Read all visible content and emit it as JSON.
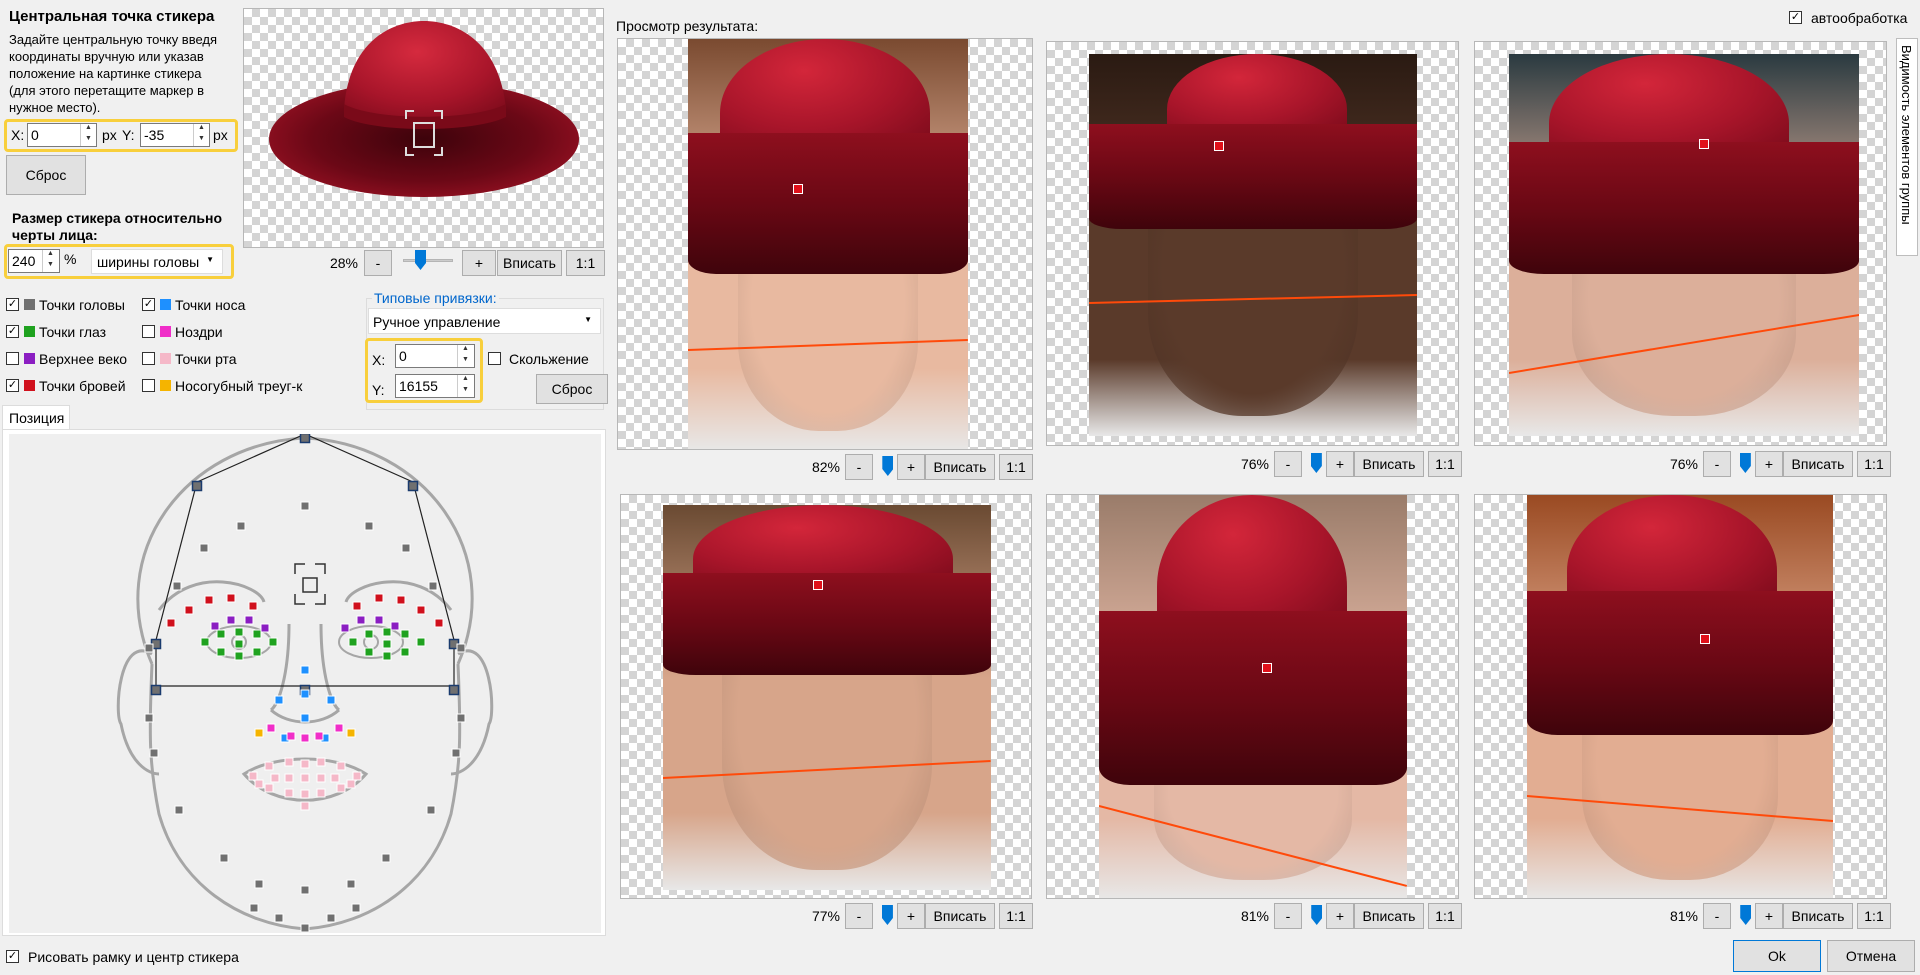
{
  "left": {
    "center_title": "Центральная точка стикера",
    "center_desc": "Задайте центральную точку введя координаты вручную или указав положение на картинке стикера (для этого перетащите маркер в нужное место).",
    "x_label": "X:",
    "x_value": "0",
    "x_unit": "px",
    "y_label": "Y:",
    "y_value": "-35",
    "y_unit": "px",
    "reset_label": "Сброс",
    "size_title": "Размер стикера относительно черты лица:",
    "size_value": "240",
    "size_unit": "%",
    "size_mode": "ширины головы",
    "sticker_zoom": "28%",
    "zoom_minus": "-",
    "zoom_plus": "+",
    "fit_label": "Вписать",
    "one_to_one": "1:1",
    "sticker_zoom_fraction": 0.28
  },
  "points": [
    {
      "label": "Точки головы",
      "checked": true,
      "color": "#707070"
    },
    {
      "label": "Точки носа",
      "checked": true,
      "color": "#1e90ff"
    },
    {
      "label": "Точки глаз",
      "checked": true,
      "color": "#1fa21f"
    },
    {
      "label": "Ноздри",
      "checked": false,
      "color": "#f02ec8"
    },
    {
      "label": "Верхнее веко",
      "checked": false,
      "color": "#8b1ec2"
    },
    {
      "label": "Точки рта",
      "checked": false,
      "color": "#f5b8c8"
    },
    {
      "label": "Точки бровей",
      "checked": true,
      "color": "#d0101c"
    },
    {
      "label": "Носогубный треуг-к",
      "checked": false,
      "color": "#f5b400"
    }
  ],
  "snapping": {
    "group_label": "Типовые привязки:",
    "mode": "Ручное управление",
    "x_label": "X:",
    "x_value": "0",
    "y_label": "Y:",
    "y_value": "16155",
    "sliding_label": "Скольжение",
    "sliding_checked": false,
    "reset_label": "Сброс"
  },
  "position_tab": "Позиция",
  "bottom": {
    "draw_frame_label": "Рисовать рамку и центр стикера",
    "draw_frame_checked": true,
    "ok_label": "Ok",
    "cancel_label": "Отмена"
  },
  "preview": {
    "title": "Просмотр результата:",
    "auto_label": "автообработка",
    "auto_checked": true,
    "side_tab": "Видимость элементов группы",
    "items": [
      {
        "zoom": "82%",
        "zoom_fraction": 0.82
      },
      {
        "zoom": "76%",
        "zoom_fraction": 0.76
      },
      {
        "zoom": "76%",
        "zoom_fraction": 0.76
      },
      {
        "zoom": "77%",
        "zoom_fraction": 0.77
      },
      {
        "zoom": "81%",
        "zoom_fraction": 0.81
      },
      {
        "zoom": "81%",
        "zoom_fraction": 0.81
      }
    ]
  }
}
